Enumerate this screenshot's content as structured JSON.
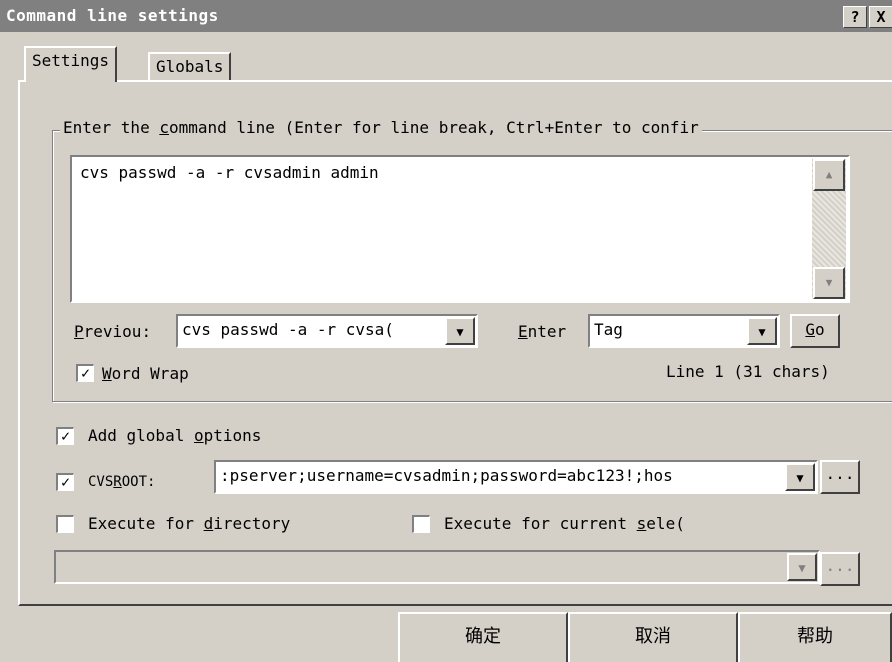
{
  "window": {
    "title": "Command line settings",
    "help_button": "?",
    "close_button": "X"
  },
  "tabs": [
    {
      "label": "Settings",
      "active": true
    },
    {
      "label": "Globals",
      "active": false
    }
  ],
  "command_group": {
    "legend_before": "Enter the ",
    "legend_accel": "c",
    "legend_after": "ommand line (Enter for line break, Ctrl+Enter to confir",
    "textarea_value": "cvs passwd -a -r cvsadmin admin",
    "scroll_up_icon": "up-arrow",
    "scroll_down_icon": "down-arrow"
  },
  "previous": {
    "label_accel": "P",
    "label_rest": "reviou:",
    "value": "cvs passwd -a -r cvsa("
  },
  "enter": {
    "label_accel": "E",
    "label_rest": "nter",
    "value": "Tag"
  },
  "go_button": {
    "accel": "G",
    "rest": "o"
  },
  "word_wrap": {
    "checked": true,
    "label_accel": "W",
    "label_rest": "ord Wrap"
  },
  "line_status": "Line 1 (31 chars)",
  "add_global": {
    "checked": true,
    "label_before": "Add global ",
    "label_accel": "o",
    "label_after": "ptions"
  },
  "cvsroot": {
    "checked": true,
    "label_before": "CVS",
    "label_accel": "R",
    "label_after": "OOT:",
    "value": ":pserver;username=cvsadmin;password=abc123!;hos",
    "browse_label": "..."
  },
  "execute_directory": {
    "checked": false,
    "label_before": "Execute for ",
    "label_accel": "d",
    "label_after": "irectory"
  },
  "execute_selection": {
    "checked": false,
    "label_before": "Execute for current ",
    "label_accel": "s",
    "label_after": "ele("
  },
  "directory_combo": {
    "value": "",
    "browse_label": "..."
  },
  "footer_buttons": {
    "ok": "确定",
    "cancel": "取消",
    "help": "帮助"
  },
  "colors": {
    "title_bg": "#808080",
    "dialog_bg": "#d4d0c8"
  }
}
